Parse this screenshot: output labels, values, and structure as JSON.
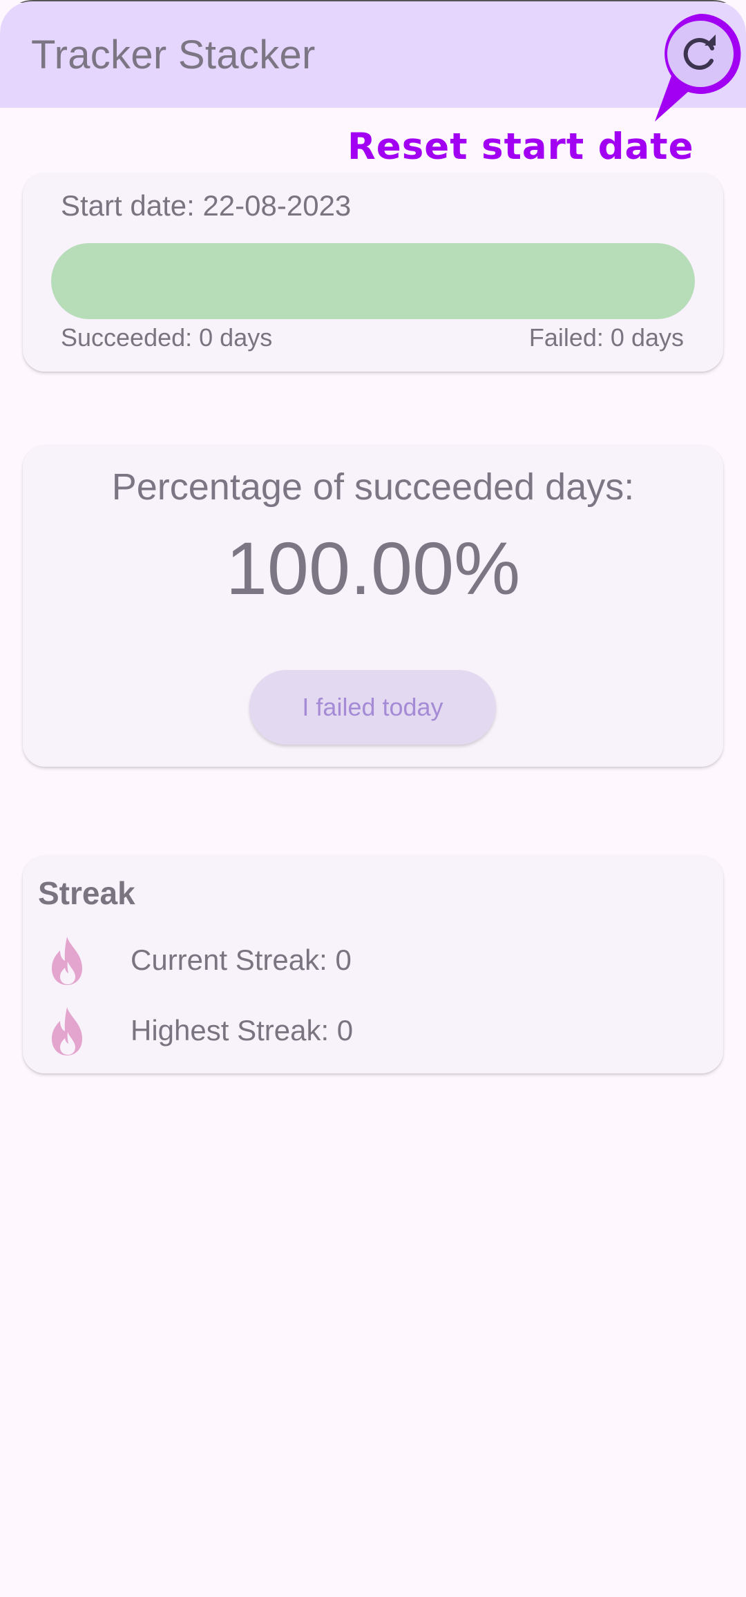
{
  "app_bar": {
    "title": "Tracker Stacker",
    "reset_icon": "refresh-icon"
  },
  "annotation": {
    "text": "Reset start date",
    "color": "#a100f2"
  },
  "start_card": {
    "start_date": "Start date: 22-08-2023",
    "succeeded": "Succeeded: 0 days",
    "failed": "Failed: 0 days",
    "progress_fraction": 1.0,
    "progress_color": "#b7ddb8"
  },
  "percent_card": {
    "heading": "Percentage of succeeded days:",
    "value": "100.00%",
    "button_label": "I failed today"
  },
  "streak_card": {
    "title": "Streak",
    "icon": "flame-icon",
    "current": "Current Streak: 0",
    "highest": "Highest Streak: 0"
  },
  "colors": {
    "app_bar": "#e4d6fd",
    "background": "#fef7fe",
    "card": "#f8f2fb",
    "flame": "#e3a4cd"
  }
}
